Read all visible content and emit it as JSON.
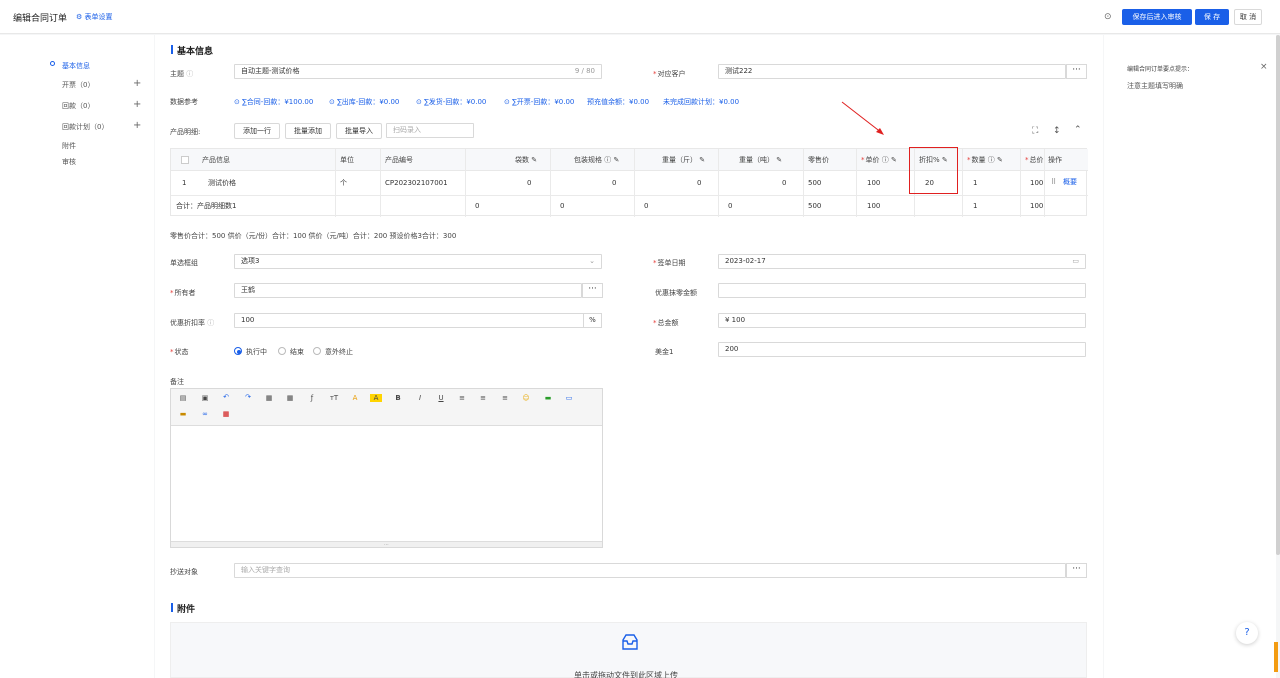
{
  "header": {
    "title": "编辑合同订单",
    "form_settings": "表单设置",
    "save_submit": "保存后进入审核",
    "save": "保 存",
    "cancel": "取 消"
  },
  "sidebar": {
    "items": [
      {
        "label": "基本信息",
        "active": true
      },
      {
        "label": "开票（0）"
      },
      {
        "label": "回款（0）"
      },
      {
        "label": "回款计划（0）"
      },
      {
        "label": "附件"
      },
      {
        "label": "审核"
      }
    ]
  },
  "basic": {
    "section_title": "基本信息",
    "subject_label": "主题",
    "subject_value": "自动主题-测试价格",
    "subject_count": "9 / 80",
    "customer_label": "对应客户",
    "customer_value": "测试222",
    "ref_label": "数据参考",
    "refs": [
      "∑合同-回款：¥100.00",
      "∑出库-回款：¥0.00",
      "∑发货-回款：¥0.00",
      "∑开票-回款：¥0.00",
      "预充值余额：¥0.00",
      "未完成回款计划：¥0.00"
    ],
    "product_label": "产品明细:",
    "add_row": "添加一行",
    "batch_add": "批量添加",
    "batch_import": "批量导入",
    "scan_placeholder": "扫码录入"
  },
  "table": {
    "headers": [
      "产品信息",
      "单位",
      "产品编号",
      "袋数",
      "包装规格",
      "重量（斤）",
      "重量（吨）",
      "零售价",
      "单价",
      "折扣%",
      "数量",
      "总价",
      "操作"
    ],
    "row": {
      "index": "1",
      "product": "测试价格",
      "unit": "个",
      "code": "CP202302107001",
      "bags": "0",
      "pack": "0",
      "weight_jin": "0",
      "weight_ton": "0",
      "retail": "500",
      "price": "100",
      "discount": "20",
      "qty": "1",
      "total": "100",
      "op": "概要"
    },
    "total_row": {
      "label": "合计：产品明细数1",
      "bags": "0",
      "pack": "0",
      "weight_jin": "0",
      "weight_ton": "0",
      "retail": "500",
      "price": "100",
      "qty": "1",
      "total": "100"
    },
    "summary": "零售价合计：500  供价（元/份）合计：100  供价（元/吨）合计：200  预设价格3合计：300"
  },
  "form": {
    "single_label": "单选框组",
    "single_value": "选项3",
    "sign_date_label": "签单日期",
    "sign_date_value": "2023-02-17",
    "owner_label": "所有者",
    "owner_value": "王鹤",
    "discount_amount_label": "优惠抹零金额",
    "discount_rate_label": "优惠折扣率",
    "discount_rate_value": "100",
    "discount_rate_unit": "%",
    "total_label": "总金额",
    "total_value": "¥ 100",
    "status_label": "状态",
    "status_options": [
      "执行中",
      "结束",
      "意外终止"
    ],
    "usd_label": "美金1",
    "usd_value": "200",
    "remark_label": "备注",
    "cc_label": "抄送对象",
    "cc_placeholder": "输入关键字查询"
  },
  "attachment": {
    "section_title": "附件",
    "upload_text": "单击或拖动文件到此区域上传"
  },
  "tips": {
    "title": "编辑合同订单要点提示：",
    "text": "注意主题填写明确"
  }
}
